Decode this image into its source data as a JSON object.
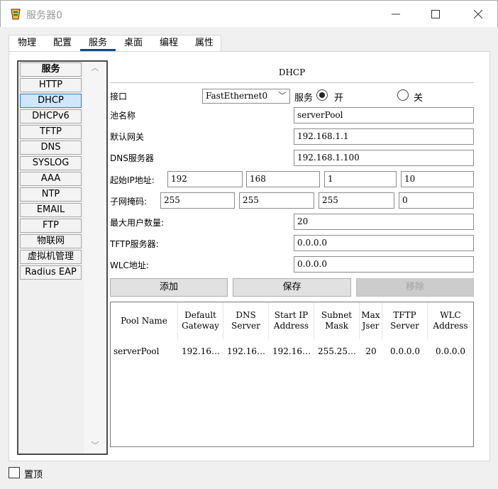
{
  "window": {
    "title": "服务器0"
  },
  "tabs": [
    {
      "label": "物理"
    },
    {
      "label": "配置"
    },
    {
      "label": "服务",
      "active": true
    },
    {
      "label": "桌面"
    },
    {
      "label": "编程"
    },
    {
      "label": "属性"
    }
  ],
  "services": {
    "header": "服务",
    "items": [
      "HTTP",
      "DHCP",
      "DHCPv6",
      "TFTP",
      "DNS",
      "SYSLOG",
      "AAA",
      "NTP",
      "EMAIL",
      "FTP",
      "物联网",
      "虚拟机管理",
      "Radius EAP"
    ],
    "selected": "DHCP"
  },
  "dhcp": {
    "section_title": "DHCP",
    "interface_label": "接口",
    "interface_value": "FastEthernet0",
    "service_label": "服务",
    "on_label": "开",
    "off_label": "关",
    "service_state": "on",
    "pool_name_label": "池名称",
    "pool_name": "serverPool",
    "gateway_label": "默认网关",
    "gateway": "192.168.1.1",
    "dns_label": "DNS服务器",
    "dns": "192.168.1.100",
    "start_ip_label": "起始IP地址:",
    "start_ip": [
      "192",
      "168",
      "1",
      "10"
    ],
    "mask_label": "子网掩码:",
    "mask": [
      "255",
      "255",
      "255",
      "0"
    ],
    "max_users_label": "最大用户数量:",
    "max_users": "20",
    "tftp_label": "TFTP服务器:",
    "tftp": "0.0.0.0",
    "wlc_label": "WLC地址:",
    "wlc": "0.0.0.0",
    "add_label": "添加",
    "save_label": "保存",
    "remove_label": "移除"
  },
  "pool_table": {
    "columns": [
      "Pool Name",
      "Default Gateway",
      "DNS Server",
      "Start IP Address",
      "Subnet Mask",
      "Max Jser",
      "TFTP Server",
      "WLC Address"
    ],
    "rows": [
      [
        "serverPool",
        "192.16…",
        "192.16…",
        "192.16…",
        "255.25…",
        "20",
        "0.0.0.0",
        "0.0.0.0"
      ]
    ]
  },
  "footer": {
    "pin_label": "置顶"
  },
  "colors": {
    "accent": "#0f4c8a",
    "selected_bg": "#cfe6fb",
    "disabled_button": "#cccccc"
  }
}
